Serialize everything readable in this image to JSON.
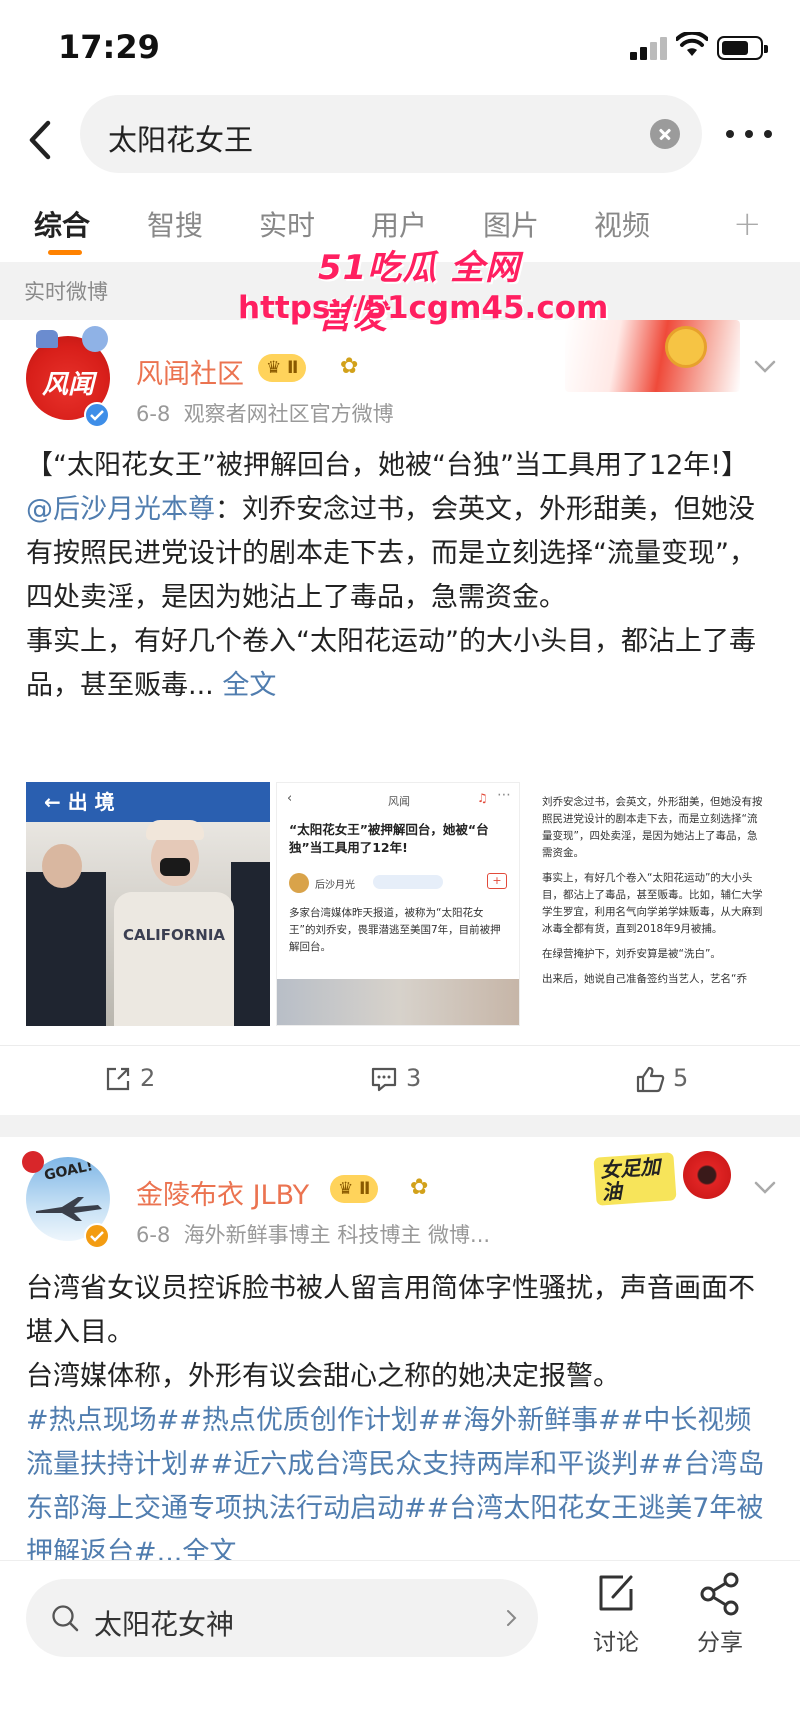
{
  "status_bar": {
    "time": "17:29"
  },
  "search": {
    "query": "太阳花女王"
  },
  "tabs": [
    "综合",
    "智搜",
    "实时",
    "用户",
    "图片",
    "视频"
  ],
  "section_label": "实时微博",
  "watermark": {
    "line1": "51吃瓜 全网首发",
    "line2": "https://51cgm45.com"
  },
  "posts": [
    {
      "user_name": "风闻社区",
      "level": "Ⅱ",
      "date": "6-8",
      "source": "观察者网社区官方微博",
      "avatar_text": "风闻",
      "text_part1": "【“太阳花女王”被押解回台，她被“台独”当工具用了12年!】",
      "mention": "@后沙月光本尊",
      "text_part2": "：刘乔安念过书，会英文，外形甜美，但她没有按照民进党设计的剧本走下去，而是立刻选择“流量变现”，四处卖淫，是因为她沾上了毒品，急需资金。",
      "text_part3": "事实上，有好几个卷入“太阳花运动”的大小头目，都沾上了毒品，甚至贩毒...",
      "full_text": "全文",
      "image1": {
        "banner": "← 出 境",
        "shirt": "CALIFORNIA"
      },
      "image2": {
        "header": "风闻",
        "title": "“太阳花女王”被押解回台，她被“台独”当工具用了12年!",
        "author": "后沙月光",
        "body": "多家台湾媒体昨天报道，被称为“太阳花女王”的刘乔安，畏罪潜逃至美国7年，目前被押解回台。"
      },
      "image3": {
        "p1": "刘乔安念过书，会英文，外形甜美，但她没有按照民进党设计的剧本走下去，而是立刻选择“流量变现”，四处卖淫，是因为她沾上了毒品，急需资金。",
        "p2": "事实上，有好几个卷入“太阳花运动”的大小头目，都沾上了毒品，甚至贩毒。比如，辅仁大学学生罗宜，利用名气向学弟学妹贩毒，从大麻到冰毒全都有货，直到2018年9月被捕。",
        "p3": "在绿营掩护下，刘乔安算是被“洗白”。",
        "p4": "出来后，她说自己准备签约当艺人，艺名“乔"
      },
      "reposts": "2",
      "comments": "3",
      "likes": "5"
    },
    {
      "user_name": "金陵布衣 JLBY",
      "level": "Ⅱ",
      "date": "6-8",
      "source": "海外新鲜事博主 科技博主 微博...",
      "avatar_text": "GOAL!",
      "deco_text": "女足加油",
      "line1": "台湾省女议员控诉脸书被人留言用简体字性骚扰，声音画面不堪入目。",
      "line2": "台湾媒体称，外形有议会甜心之称的她决定报警。",
      "hashtags": "#热点现场##热点优质创作计划##海外新鲜事##中长视频流量扶持计划##近六成台湾民众支持两岸和平谈判##台湾岛东部海上交通专项执法行动启动##台湾太阳花女王逃美7年被押解返台#",
      "full_text": "...全文"
    }
  ],
  "bottom": {
    "search_hint": "太阳花女神",
    "discuss": "讨论",
    "share": "分享"
  }
}
